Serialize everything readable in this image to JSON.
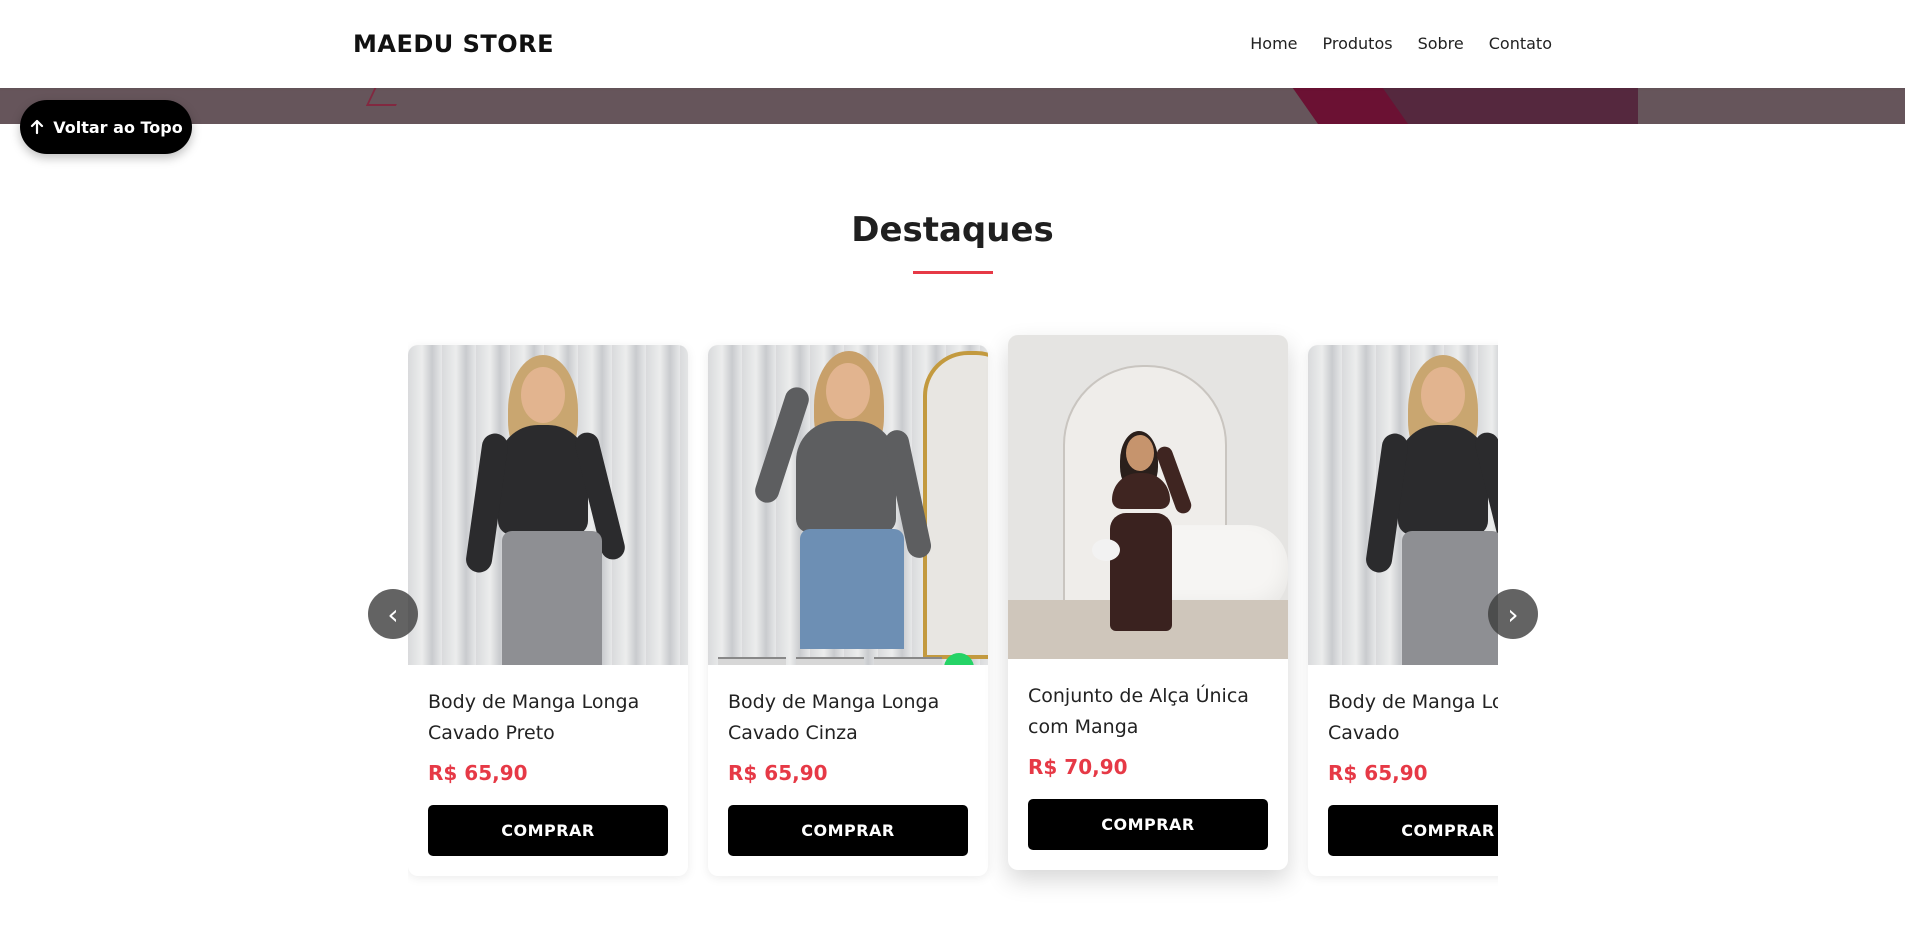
{
  "header": {
    "logo": "MAEDU STORE",
    "nav": [
      "Home",
      "Produtos",
      "Sobre",
      "Contato"
    ]
  },
  "back_to_top": {
    "label": "Voltar ao Topo",
    "icon": "arrow-up-icon"
  },
  "section": {
    "title": "Destaques",
    "accent_color": "#e63946"
  },
  "carousel": {
    "prev_label": "‹",
    "next_label": "›",
    "products": [
      {
        "name": "Body de Manga Longa Cavado Preto",
        "price": "R$ 65,90",
        "button": "COMPRAR"
      },
      {
        "name": "Body de Manga Longa Cavado Cinza",
        "price": "R$ 65,90",
        "button": "COMPRAR"
      },
      {
        "name": "Conjunto de Alça Única com Manga",
        "price": "R$ 70,90",
        "button": "COMPRAR"
      },
      {
        "name": "Body de Manga Longa Cavado",
        "price": "R$ 65,90",
        "button": "COMPRAR"
      }
    ]
  },
  "colors": {
    "price": "#e63946",
    "button_bg": "#000000",
    "hero_strip": "#66555b"
  }
}
